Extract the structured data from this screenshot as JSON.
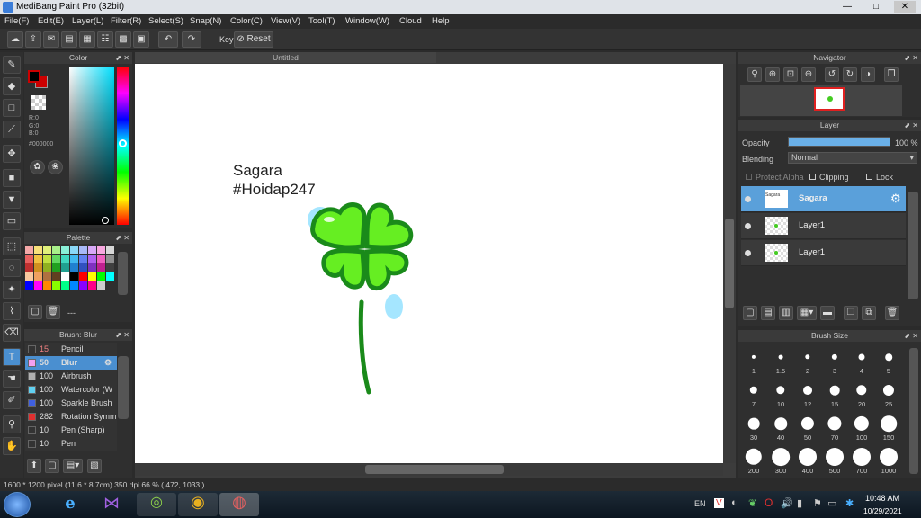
{
  "window": {
    "title": "MediBang Paint Pro (32bit)",
    "min": "—",
    "max": "□",
    "close": "✕"
  },
  "menu": [
    "File(F)",
    "Edit(E)",
    "Layer(L)",
    "Filter(R)",
    "Select(S)",
    "Snap(N)",
    "Color(C)",
    "View(V)",
    "Tool(T)",
    "Window(W)",
    "Cloud",
    "Help"
  ],
  "toolbar": {
    "key_label": "Key",
    "reset_label": "Reset"
  },
  "color_panel": {
    "title": "Color",
    "r": "R:0",
    "g": "G:0",
    "b": "B:0",
    "hex": "#000000",
    "primary": "#000000",
    "secondary": "#cc0000"
  },
  "palette_panel": {
    "title": "Palette",
    "footer": "---",
    "colors": [
      "#f4a8a8",
      "#f8e07a",
      "#e0f07a",
      "#a8f08a",
      "#8af0d8",
      "#8ad8f8",
      "#a8b8f8",
      "#d8a8f8",
      "#f8a8e0",
      "#d8d8d8",
      "#e86060",
      "#f0c040",
      "#c0e040",
      "#60d860",
      "#40d8c0",
      "#40b8f0",
      "#6080f0",
      "#b060f0",
      "#f060c0",
      "#909090",
      "#c03030",
      "#d09020",
      "#90b020",
      "#20a020",
      "#20a090",
      "#2080d0",
      "#3050c0",
      "#8030c0",
      "#c02090",
      "#404040",
      "#f8c8a0",
      "#f0a060",
      "#b07040",
      "#604020",
      "#ffffff",
      "#000000",
      "#ff0000",
      "#ffff00",
      "#00ff00",
      "#00ffff",
      "#0000ff",
      "#ff00ff",
      "#ff8800",
      "#88ff00",
      "#00ff88",
      "#0088ff",
      "#8800ff",
      "#ff0088",
      "#cccccc"
    ]
  },
  "brush_panel": {
    "title": "Brush: Blur",
    "items": [
      {
        "size": "15",
        "name": "Pencil",
        "color": "#333333"
      },
      {
        "size": "50",
        "name": "Blur",
        "color": "#f4a0f0"
      },
      {
        "size": "100",
        "name": "Airbrush",
        "color": "#b0b0b0"
      },
      {
        "size": "100",
        "name": "Watercolor (W",
        "color": "#60d0f0"
      },
      {
        "size": "100",
        "name": "Sparkle Brush",
        "color": "#4060e0"
      },
      {
        "size": "282",
        "name": "Rotation Symm",
        "color": "#e03030"
      },
      {
        "size": "10",
        "name": "Pen (Sharp)",
        "color": "#333333"
      },
      {
        "size": "10",
        "name": "Pen",
        "color": "#333333"
      }
    ]
  },
  "canvas": {
    "tab": "Untitled",
    "text_line1": "Sagara",
    "text_line2": "#Hoidap247"
  },
  "navigator": {
    "title": "Navigator"
  },
  "layer_panel": {
    "title": "Layer",
    "opacity_label": "Opacity",
    "opacity_value": "100 %",
    "opacity": 1.0,
    "blending_label": "Blending",
    "blending_value": "Normal",
    "protect_alpha": "Protect Alpha",
    "clipping": "Clipping",
    "lock": "Lock",
    "layers": [
      {
        "name": "Sagara",
        "selected": true
      },
      {
        "name": "Layer1",
        "selected": false
      },
      {
        "name": "Layer1",
        "selected": false
      }
    ]
  },
  "brush_size_panel": {
    "title": "Brush Size",
    "sizes": [
      "1",
      "1.5",
      "2",
      "3",
      "4",
      "5",
      "7",
      "10",
      "12",
      "15",
      "20",
      "25",
      "30",
      "40",
      "50",
      "70",
      "100",
      "150",
      "200",
      "300",
      "400",
      "500",
      "700",
      "1000"
    ]
  },
  "status": {
    "text": "1600 * 1200 pixel   (11.6 * 8.7cm)   350 dpi   66 %   ( 472, 1033 )"
  },
  "taskbar": {
    "lang": "EN",
    "time": "10:48 AM",
    "date": "10/29/2021"
  }
}
